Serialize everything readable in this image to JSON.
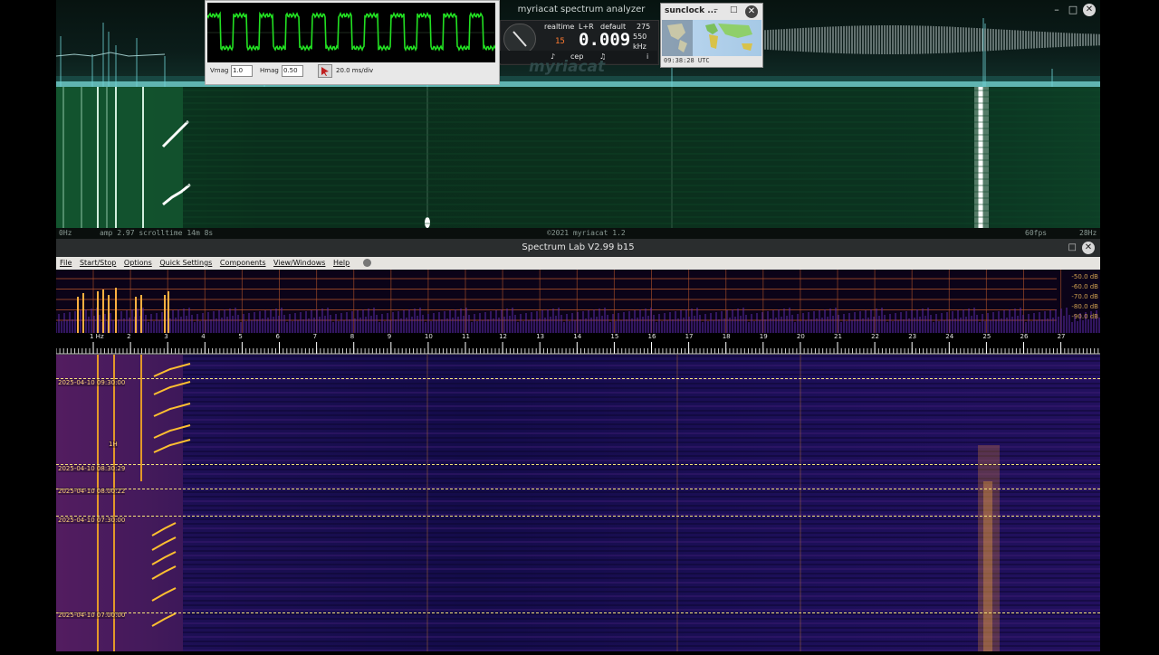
{
  "myriacat": {
    "title": "myriacat spectrum analyzer",
    "status_left_hz": "0Hz",
    "status_params": "amp 2.97   scrolltime 14m 8s",
    "status_center": "©2021 myriacat 1.2",
    "status_fps": "60fps",
    "status_right_hz": "28Hz",
    "panel": {
      "mode": "realtime",
      "channel": "L+R",
      "preset": "default",
      "count": "275",
      "value": "0.009",
      "rate": "550",
      "unit": "kHz",
      "small_num": "15",
      "btn_left": "♪",
      "btn_mid": "cep",
      "btn_right": "♫",
      "info": "i",
      "watermark": "myriacat"
    },
    "window_buttons": {
      "minimize": "–",
      "maximize": "□",
      "close": "✕"
    }
  },
  "scope": {
    "vmag_label": "Vmag",
    "vmag_value": "1.0",
    "hmag_label": "Hmag",
    "hmag_value": "0.50",
    "timebase": "20.0 ms/div"
  },
  "sunclock": {
    "title": "sunclock ...",
    "time": "09:38:28 UTC",
    "window_buttons": {
      "minimize": "–",
      "maximize": "□",
      "close": "✕"
    }
  },
  "spectrum_lab": {
    "title": "Spectrum Lab V2.99 b15",
    "menu": [
      "File",
      "Start/Stop",
      "Options",
      "Quick Settings",
      "Components",
      "View/Windows",
      "Help"
    ],
    "db_labels": [
      "-50.0 dB",
      "-60.0 dB",
      "-70.0 dB",
      "-80.0 dB",
      "-90.0 dB"
    ],
    "freq_labels": [
      "1 Hz",
      "2",
      "3",
      "4",
      "5",
      "6",
      "7",
      "8",
      "9",
      "10",
      "11",
      "12",
      "13",
      "14",
      "15",
      "16",
      "17",
      "18",
      "19",
      "20",
      "21",
      "22",
      "23",
      "24",
      "25",
      "26",
      "27"
    ],
    "timestamps": [
      "2025-04-10 09:30:00",
      "2025-04-10 08:30:29",
      "2025-04-10 08:00:22",
      "2025-04-10 07:30:00",
      "2025-04-10 07:00:00"
    ],
    "marker": "1H",
    "window_buttons": {
      "maximize": "□",
      "close": "✕"
    }
  },
  "colors": {
    "spectrum_lab_dash": "#f5e27a",
    "scope_trace": "#22e022",
    "top_waterfall": "#0b3320",
    "sl_waterfall": "#1c0f58",
    "signal_orange": "#ffb020"
  }
}
